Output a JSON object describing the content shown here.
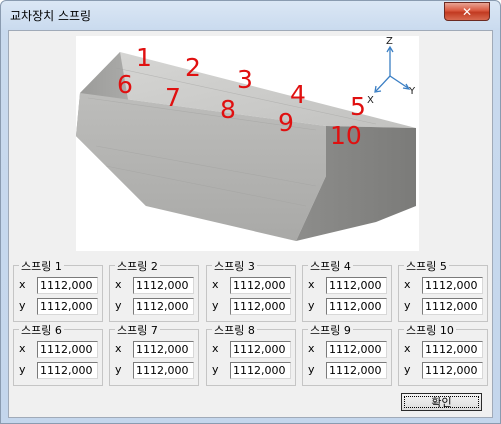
{
  "window": {
    "title": "교차장치 스프링",
    "close_glyph": "✕"
  },
  "figure": {
    "markers": [
      "1",
      "2",
      "3",
      "4",
      "5",
      "6",
      "7",
      "8",
      "9",
      "10"
    ],
    "axes": {
      "z": "Z",
      "x": "X",
      "y": "Y"
    },
    "marker_color": "#e01010",
    "axis_color": "#3b7fc4"
  },
  "springs": [
    {
      "label": "스프링 1",
      "x_label": "x",
      "y_label": "y",
      "x_value": "1112,000",
      "y_value": "1112,000"
    },
    {
      "label": "스프링 2",
      "x_label": "x",
      "y_label": "y",
      "x_value": "1112,000",
      "y_value": "1112,000"
    },
    {
      "label": "스프링 3",
      "x_label": "x",
      "y_label": "y",
      "x_value": "1112,000",
      "y_value": "1112,000"
    },
    {
      "label": "스프링 4",
      "x_label": "x",
      "y_label": "y",
      "x_value": "1112,000",
      "y_value": "1112,000"
    },
    {
      "label": "스프링 5",
      "x_label": "x",
      "y_label": "y",
      "x_value": "1112,000",
      "y_value": "1112,000"
    },
    {
      "label": "스프링 6",
      "x_label": "x",
      "y_label": "y",
      "x_value": "1112,000",
      "y_value": "1112,000"
    },
    {
      "label": "스프링 7",
      "x_label": "x",
      "y_label": "y",
      "x_value": "1112,000",
      "y_value": "1112,000"
    },
    {
      "label": "스프링 8",
      "x_label": "x",
      "y_label": "y",
      "x_value": "1112,000",
      "y_value": "1112,000"
    },
    {
      "label": "스프링 9",
      "x_label": "x",
      "y_label": "y",
      "x_value": "1112,000",
      "y_value": "1112,000"
    },
    {
      "label": "스프링 10",
      "x_label": "x",
      "y_label": "y",
      "x_value": "1112,000",
      "y_value": "1112,000"
    }
  ],
  "buttons": {
    "ok_label": "확인"
  }
}
